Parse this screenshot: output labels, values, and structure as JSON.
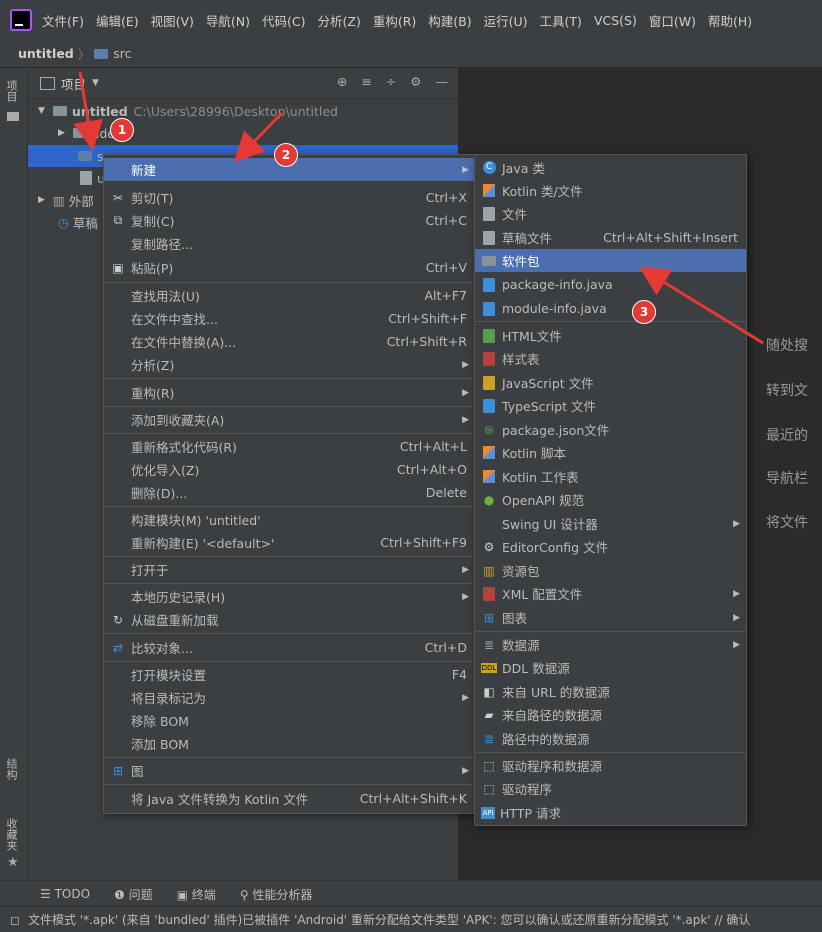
{
  "menubar": {
    "items": [
      "文件(F)",
      "编辑(E)",
      "视图(V)",
      "导航(N)",
      "代码(C)",
      "分析(Z)",
      "重构(R)",
      "构建(B)",
      "运行(U)",
      "工具(T)",
      "VCS(S)",
      "窗口(W)",
      "帮助(H)"
    ]
  },
  "breadcrumb": {
    "project": "untitled",
    "folder": "src"
  },
  "left_strip": {
    "project_tab": "项目",
    "structure_tab": "结构",
    "favorites_tab": "收藏夹"
  },
  "project_panel": {
    "title": "项目",
    "root_name": "untitled",
    "root_path": "C:\\Users\\28996\\Desktop\\untitled",
    "idea_folder": ".idea",
    "src_folder": "src",
    "iml_file": "u",
    "external": "外部",
    "scratch": "草稿"
  },
  "context_menu": {
    "items": [
      {
        "label": "新建",
        "shortcut": "",
        "submenu": true,
        "selected": true
      },
      {
        "label": "剪切(T)",
        "shortcut": "Ctrl+X"
      },
      {
        "label": "复制(C)",
        "shortcut": "Ctrl+C"
      },
      {
        "label": "复制路径...",
        "shortcut": ""
      },
      {
        "label": "粘贴(P)",
        "shortcut": "Ctrl+V"
      },
      {
        "label": "查找用法(U)",
        "shortcut": "Alt+F7"
      },
      {
        "label": "在文件中查找...",
        "shortcut": "Ctrl+Shift+F"
      },
      {
        "label": "在文件中替换(A)...",
        "shortcut": "Ctrl+Shift+R"
      },
      {
        "label": "分析(Z)",
        "shortcut": "",
        "submenu": true
      },
      {
        "label": "重构(R)",
        "shortcut": "",
        "submenu": true
      },
      {
        "label": "添加到收藏夹(A)",
        "shortcut": "",
        "submenu": true
      },
      {
        "label": "重新格式化代码(R)",
        "shortcut": "Ctrl+Alt+L"
      },
      {
        "label": "优化导入(Z)",
        "shortcut": "Ctrl+Alt+O"
      },
      {
        "label": "删除(D)...",
        "shortcut": "Delete"
      },
      {
        "label": "构建模块(M) 'untitled'",
        "shortcut": ""
      },
      {
        "label": "重新构建(E) '<default>'",
        "shortcut": "Ctrl+Shift+F9"
      },
      {
        "label": "打开于",
        "shortcut": "",
        "submenu": true
      },
      {
        "label": "本地历史记录(H)",
        "shortcut": "",
        "submenu": true
      },
      {
        "label": "从磁盘重新加载",
        "shortcut": ""
      },
      {
        "label": "比较对象...",
        "shortcut": "Ctrl+D"
      },
      {
        "label": "打开模块设置",
        "shortcut": "F4"
      },
      {
        "label": "将目录标记为",
        "shortcut": "",
        "submenu": true
      },
      {
        "label": "移除 BOM",
        "shortcut": ""
      },
      {
        "label": "添加 BOM",
        "shortcut": ""
      },
      {
        "label": "图",
        "shortcut": "",
        "submenu": true
      },
      {
        "label": "将 Java 文件转换为 Kotlin 文件",
        "shortcut": "Ctrl+Alt+Shift+K"
      }
    ]
  },
  "submenu": {
    "items": [
      {
        "label": "Java 类",
        "shortcut": ""
      },
      {
        "label": "Kotlin 类/文件",
        "shortcut": ""
      },
      {
        "label": "文件",
        "shortcut": ""
      },
      {
        "label": "草稿文件",
        "shortcut": "Ctrl+Alt+Shift+Insert"
      },
      {
        "label": "软件包",
        "shortcut": "",
        "selected": true
      },
      {
        "label": "package-info.java",
        "shortcut": ""
      },
      {
        "label": "module-info.java",
        "shortcut": ""
      },
      {
        "label": "HTML文件",
        "shortcut": ""
      },
      {
        "label": "样式表",
        "shortcut": ""
      },
      {
        "label": "JavaScript 文件",
        "shortcut": ""
      },
      {
        "label": "TypeScript 文件",
        "shortcut": ""
      },
      {
        "label": "package.json文件",
        "shortcut": ""
      },
      {
        "label": "Kotlin 脚本",
        "shortcut": ""
      },
      {
        "label": "Kotlin 工作表",
        "shortcut": ""
      },
      {
        "label": "OpenAPI 规范",
        "shortcut": ""
      },
      {
        "label": "Swing UI 设计器",
        "shortcut": "",
        "submenu": true
      },
      {
        "label": "EditorConfig 文件",
        "shortcut": ""
      },
      {
        "label": "资源包",
        "shortcut": ""
      },
      {
        "label": "XML 配置文件",
        "shortcut": "",
        "submenu": true
      },
      {
        "label": "图表",
        "shortcut": "",
        "submenu": true
      },
      {
        "label": "数据源",
        "shortcut": "",
        "submenu": true
      },
      {
        "label": "DDL 数据源",
        "shortcut": ""
      },
      {
        "label": "来自 URL 的数据源",
        "shortcut": ""
      },
      {
        "label": "来自路径的数据源",
        "shortcut": ""
      },
      {
        "label": "路径中的数据源",
        "shortcut": ""
      },
      {
        "label": "驱动程序和数据源",
        "shortcut": ""
      },
      {
        "label": "驱动程序",
        "shortcut": ""
      },
      {
        "label": "HTTP 请求",
        "shortcut": ""
      }
    ]
  },
  "editor_hints": [
    "随处搜",
    "转到文",
    "最近的",
    "导航栏",
    "将文件"
  ],
  "badges": [
    "1",
    "2",
    "3"
  ],
  "tool_windows": [
    "TODO",
    "问题",
    "终端",
    "性能分析器"
  ],
  "status_message": "文件模式 '*.apk' (来自 'bundled' 插件)已被插件 'Android' 重新分配给文件类型 'APK': 您可以确认或还原重新分配模式 '*.apk' // 确认",
  "colors": {
    "accent": "#4b6eaf",
    "badge": "#e53935",
    "selection": "#2f65ca"
  }
}
